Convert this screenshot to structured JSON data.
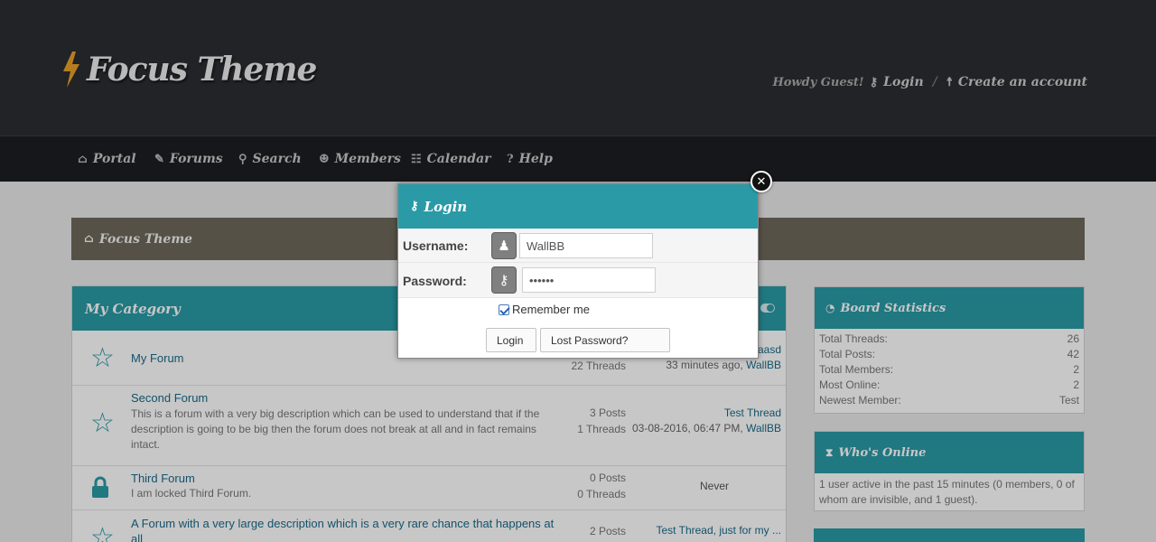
{
  "header": {
    "logo_text": "Focus Theme",
    "welcome": {
      "greeting": "Howdy Guest!",
      "login_label": "Login",
      "separator": "/",
      "register_label": "Create an account"
    }
  },
  "nav": {
    "items": [
      {
        "label": "Portal",
        "icon": "home-icon"
      },
      {
        "label": "Forums",
        "icon": "comments-icon"
      },
      {
        "label": "Search",
        "icon": "search-icon"
      },
      {
        "label": "Members",
        "icon": "users-icon"
      },
      {
        "label": "Calendar",
        "icon": "calendar-icon"
      },
      {
        "label": "Help",
        "icon": "help-icon"
      }
    ]
  },
  "breadcrumb": {
    "label": "Focus Theme",
    "icon": "home-icon"
  },
  "category": {
    "title": "My Category",
    "forums": [
      {
        "name": "My Forum",
        "description": "",
        "posts": "",
        "threads": "22 Threads",
        "last_thread": "aasd",
        "last_time": "33 minutes ago,",
        "last_user": "WallBB",
        "status_icon": "star-icon"
      },
      {
        "name": "Second Forum",
        "description": "This is a forum with a very big description which can be used to understand that if the description is going to be big then the forum does not break at all and in fact remains intact.",
        "posts": "3 Posts",
        "threads": "1 Threads",
        "last_thread": "Test Thread",
        "last_time": "03-08-2016, 06:47 PM,",
        "last_user": "WallBB",
        "status_icon": "star-icon"
      },
      {
        "name": "Third Forum",
        "description": "I am locked Third Forum.",
        "posts": "0 Posts",
        "threads": "0 Threads",
        "last_thread": "Never",
        "status_icon": "lock-icon"
      },
      {
        "name": "A Forum with a very large description which is a very rare chance that happens at all",
        "posts": "2 Posts",
        "last_thread": "Test Thread, just for my ...",
        "status_icon": "star-icon"
      }
    ]
  },
  "board_stats": {
    "title": "Board Statistics",
    "icon": "pie-chart-icon",
    "rows": [
      {
        "label": "Total Threads:",
        "value": "26"
      },
      {
        "label": "Total Posts:",
        "value": "42"
      },
      {
        "label": "Total Members:",
        "value": "2"
      },
      {
        "label": "Most Online:",
        "value": "2"
      },
      {
        "label": "Newest Member:",
        "value": "Test"
      }
    ]
  },
  "whos_online": {
    "title": "Who's Online",
    "icon": "hourglass-icon",
    "text": "1 user active in the past 15 minutes (0 members, 0 of whom are invisible, and 1 guest)."
  },
  "login_modal": {
    "title": "Login",
    "username_label": "Username:",
    "username_value": "WallBB",
    "password_label": "Password:",
    "password_value": "••••••",
    "remember_label": "Remember me",
    "remember_checked": true,
    "login_button": "Login",
    "lost_password_button": "Lost Password?",
    "close_symbol": "✕"
  },
  "colors": {
    "accent": "#2a9aa6",
    "header_bg": "#2b2d31",
    "nav_bg": "#1d1e22",
    "breadcrumb_bg": "#6e685a",
    "link": "#1a6a8a"
  }
}
